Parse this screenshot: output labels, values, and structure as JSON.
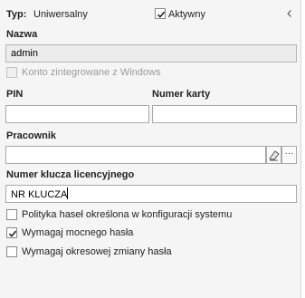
{
  "header": {
    "type_label": "Typ:",
    "type_value": "Uniwersalny",
    "active_label": "Aktywny",
    "active_checked": true,
    "collapse_icon": "chevron-left-icon"
  },
  "name": {
    "label": "Nazwa",
    "value": "admin"
  },
  "windows_integrated": {
    "label": "Konto zintegrowane z Windows",
    "checked": false,
    "enabled": false
  },
  "pin": {
    "label": "PIN",
    "value": ""
  },
  "card_number": {
    "label": "Numer karty",
    "value": ""
  },
  "employee": {
    "label": "Pracownik",
    "value": "",
    "clear_icon": "eraser-icon",
    "browse_label": "···"
  },
  "license_key": {
    "label": "Numer klucza licencyjnego",
    "value": "NR KLUCZA"
  },
  "options": [
    {
      "label": "Polityka haseł określona w konfiguracji systemu",
      "checked": false
    },
    {
      "label": "Wymagaj mocnego hasła",
      "checked": true
    },
    {
      "label": "Wymagaj okresowej zmiany hasła",
      "checked": false
    }
  ],
  "colors": {
    "panel_bg": "#f5f5f5",
    "input_border": "#a9a9a9",
    "readonly_bg": "#ececec",
    "disabled_text": "#9a9a9a"
  }
}
